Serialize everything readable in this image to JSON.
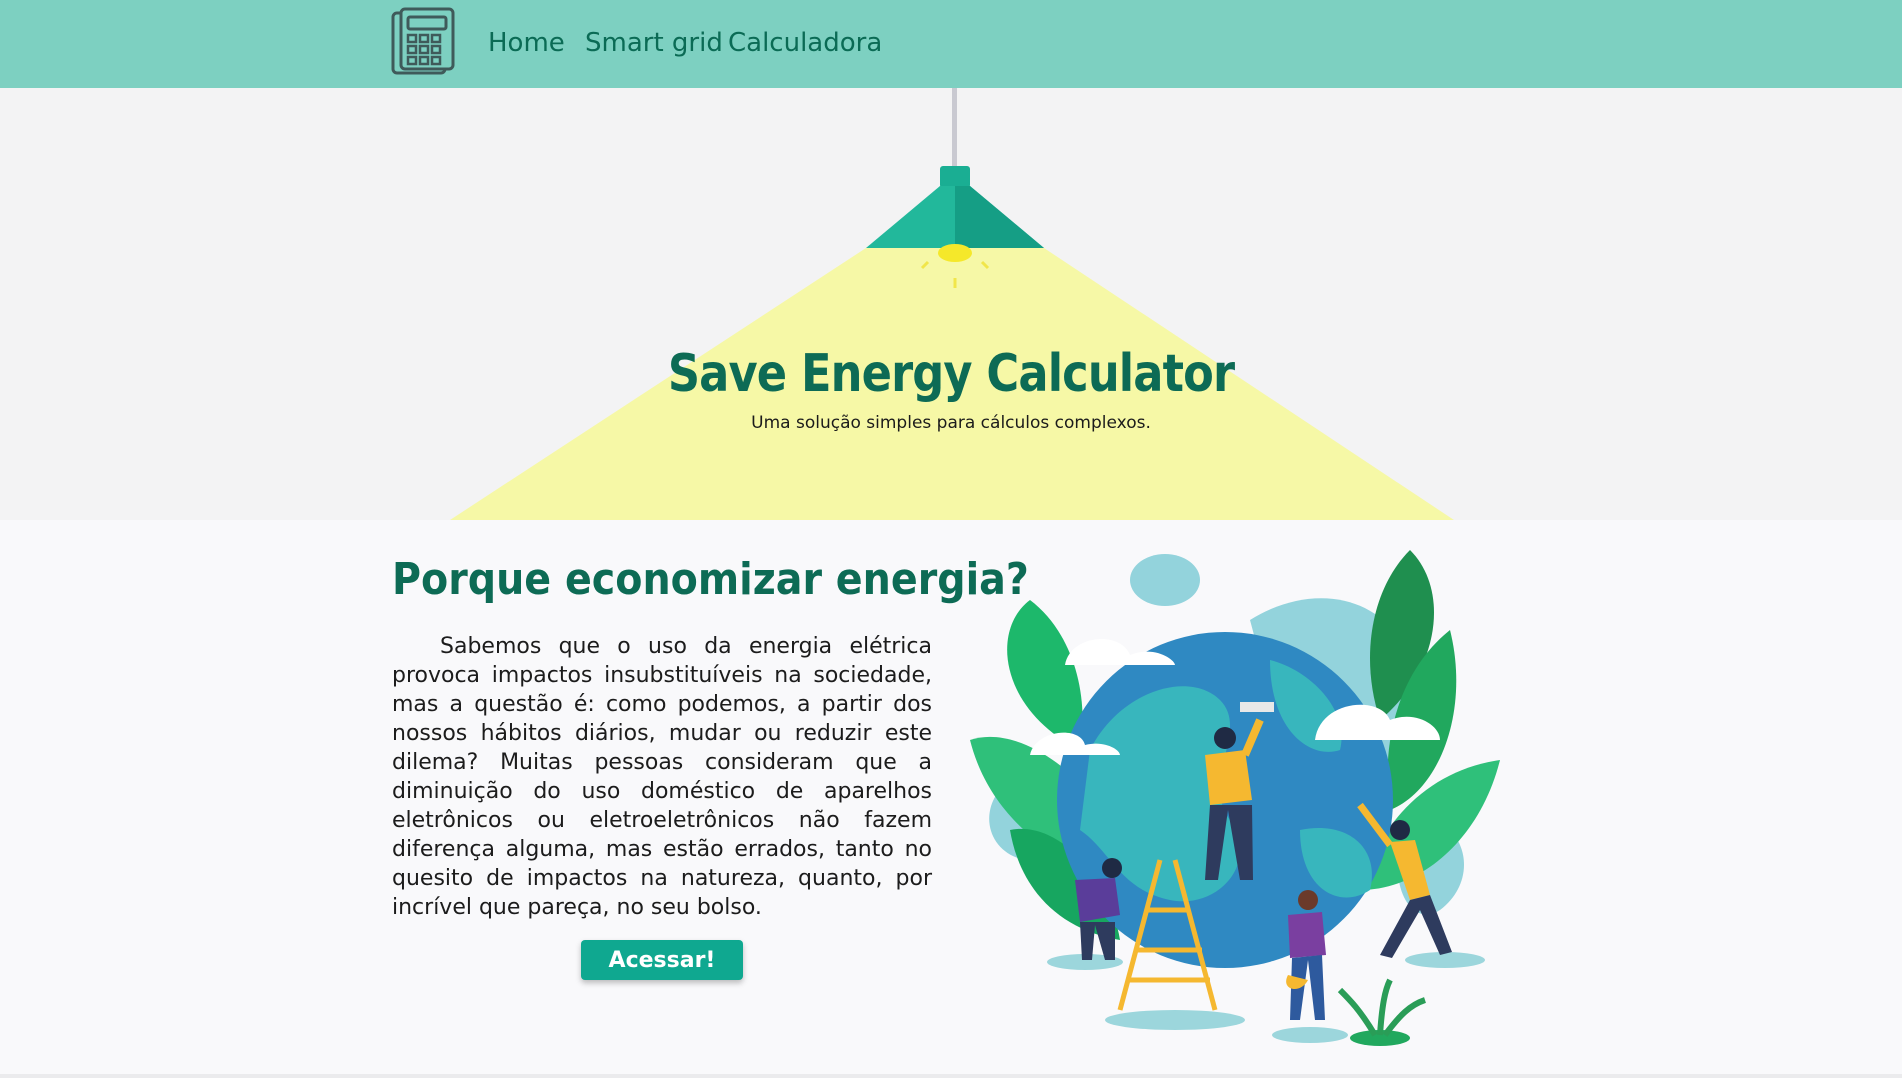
{
  "nav": {
    "logo_icon": "calculator-icon",
    "links": [
      "Home",
      "Smart grid",
      "Calculadora"
    ]
  },
  "hero": {
    "title": "Save Energy Calculator",
    "subtitle": "Uma solução simples para cálculos complexos."
  },
  "section": {
    "title": "Porque economizar energia?",
    "paragraph": "Sabemos que o uso da energia elétrica provoca impactos insubstituíveis na sociedade, mas a questão é: como podemos, a partir dos nossos hábitos diários, mudar ou reduzir este dilema? Muitas pessoas consideram que a diminuição do uso doméstico de aparelhos eletrônicos ou eletroeletrônicos não fazem diferença alguma, mas estão errados, tanto no quesito de impactos na natureza, quanto, por incrível que pareça, no seu bolso.",
    "button_label": "Acessar!"
  },
  "colors": {
    "nav_bg": "#7dd0c1",
    "accent": "#0d6b55",
    "button": "#0fa890",
    "light_beam": "#f6f8a6"
  }
}
